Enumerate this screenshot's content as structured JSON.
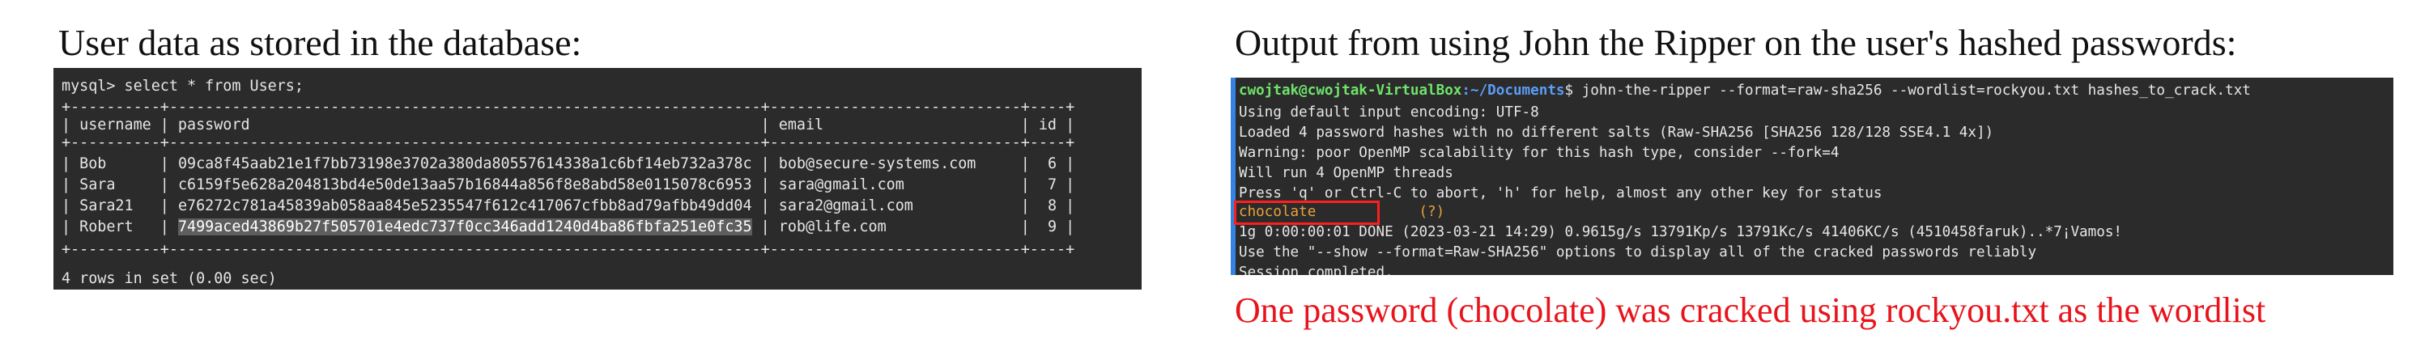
{
  "captions": {
    "left": "User data as stored in the database:",
    "right": "Output from using John the Ripper on the user's hashed passwords:",
    "result": "One password (chocolate) was cracked using rockyou.txt as the wordlist"
  },
  "mysql": {
    "prompt": "mysql> select * from Users;",
    "border": "+----------+------------------------------------------------------------------+----------------------------+----+",
    "header": "| username | password                                                         | email                      | id |",
    "rows": [
      {
        "username": "Bob",
        "password": "09ca8f45aab21e1f7bb73198e3702a380da80557614338a1c6bf14eb732a378c",
        "email": "bob@secure-systems.com",
        "id": "6"
      },
      {
        "username": "Sara",
        "password": "c6159f5e628a204813bd4e50de13aa57b16844a856f8e8abd58e0115078c6953",
        "email": "sara@gmail.com",
        "id": "7"
      },
      {
        "username": "Sara21",
        "password": "e76272c781a45839ab058aa845e5235547f612c417067cfbb8ad79afbb49dd04",
        "email": "sara2@gmail.com",
        "id": "8"
      },
      {
        "username": "Robert",
        "password": "7499aced43869b27f505701e4edc737f0cc346add1240d4ba86fbfa251e0fc35",
        "email": "rob@life.com",
        "id": "9"
      }
    ],
    "footer": "4 rows in set (0.00 sec)"
  },
  "john": {
    "prompt_user": "cwojtak@cwojtak-VirtualBox",
    "prompt_path": ":~/Documents",
    "command": "$ john-the-ripper --format=raw-sha256 --wordlist=rockyou.txt hashes_to_crack.txt",
    "lines": [
      "Using default input encoding: UTF-8",
      "Loaded 4 password hashes with no different salts (Raw-SHA256 [SHA256 128/128 SSE4.1 4x])",
      "Warning: poor OpenMP scalability for this hash type, consider --fork=4",
      "Will run 4 OpenMP threads",
      "Press 'q' or Ctrl-C to abort, 'h' for help, almost any other key for status"
    ],
    "cracked_password": "chocolate",
    "cracked_user": "(?)",
    "after_lines": [
      "1g 0:00:00:01 DONE (2023-03-21 14:29) 0.9615g/s 13791Kp/s 13791Kc/s 41406KC/s (4510458faruk)..*7¡Vamos!",
      "Use the \"--show --format=Raw-SHA256\" options to display all of the cracked passwords reliably",
      "Session completed."
    ]
  },
  "colors": {
    "terminal_bg": "#2b2b2b",
    "highlight_box": "#ff1e1e",
    "result_text": "#e8141b",
    "prompt_user": "#6fe36b",
    "prompt_path": "#5d9cf5"
  }
}
